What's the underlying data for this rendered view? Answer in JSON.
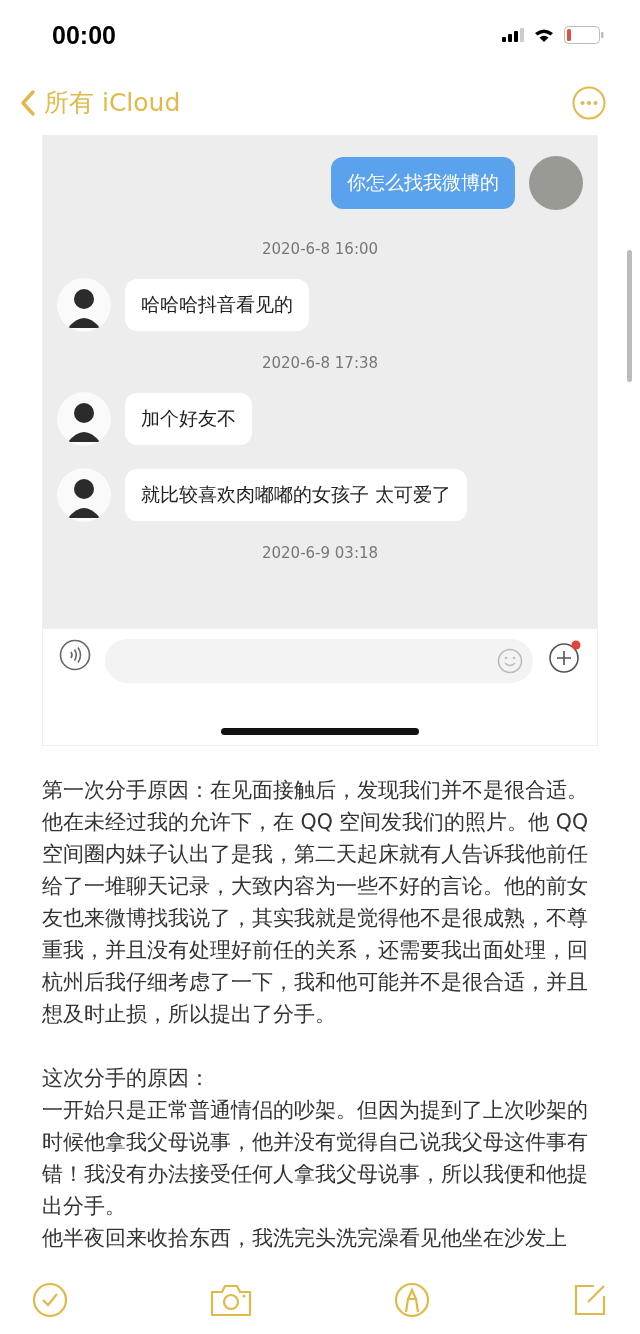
{
  "status_bar": {
    "time": "00:00"
  },
  "nav": {
    "back_label": "所有 iCloud"
  },
  "chat": {
    "messages": [
      {
        "kind": "sent",
        "text": "你怎么找我微博的"
      },
      {
        "kind": "time",
        "text": "2020-6-8 16:00"
      },
      {
        "kind": "received",
        "text": "哈哈哈抖音看见的"
      },
      {
        "kind": "time",
        "text": "2020-6-8 17:38"
      },
      {
        "kind": "received",
        "text": "加个好友不"
      },
      {
        "kind": "received",
        "text": "就比较喜欢肉嘟嘟的女孩子 太可爱了"
      },
      {
        "kind": "time",
        "text": "2020-6-9 03:18"
      }
    ]
  },
  "note": {
    "sections": [
      {
        "paragraphs": [
          "第一次分手原因：在见面接触后，发现我们并不是很合适。他在未经过我的允许下，在 QQ 空间发我们的照片。他 QQ 空间圈内妹子认出了是我，第二天起床就有人告诉我他前任给了一堆聊天记录，大致内容为一些不好的言论。他的前女友也来微博找我说了，其实我就是觉得他不是很成熟，不尊重我，并且没有处理好前任的关系，还需要我出面处理，回杭州后我仔细考虑了一下，我和他可能并不是很合适，并且想及时止损，所以提出了分手。"
        ]
      },
      {
        "paragraphs": [
          "这次分手的原因：",
          "一开始只是正常普通情侣的吵架。但因为提到了上次吵架的时候他拿我父母说事，他并没有觉得自己说我父母这件事有错！我没有办法接受任何人拿我父母说事，所以我便和他提出分手。",
          "他半夜回来收拾东西，我洗完头洗完澡看见他坐在沙发上"
        ]
      }
    ]
  }
}
